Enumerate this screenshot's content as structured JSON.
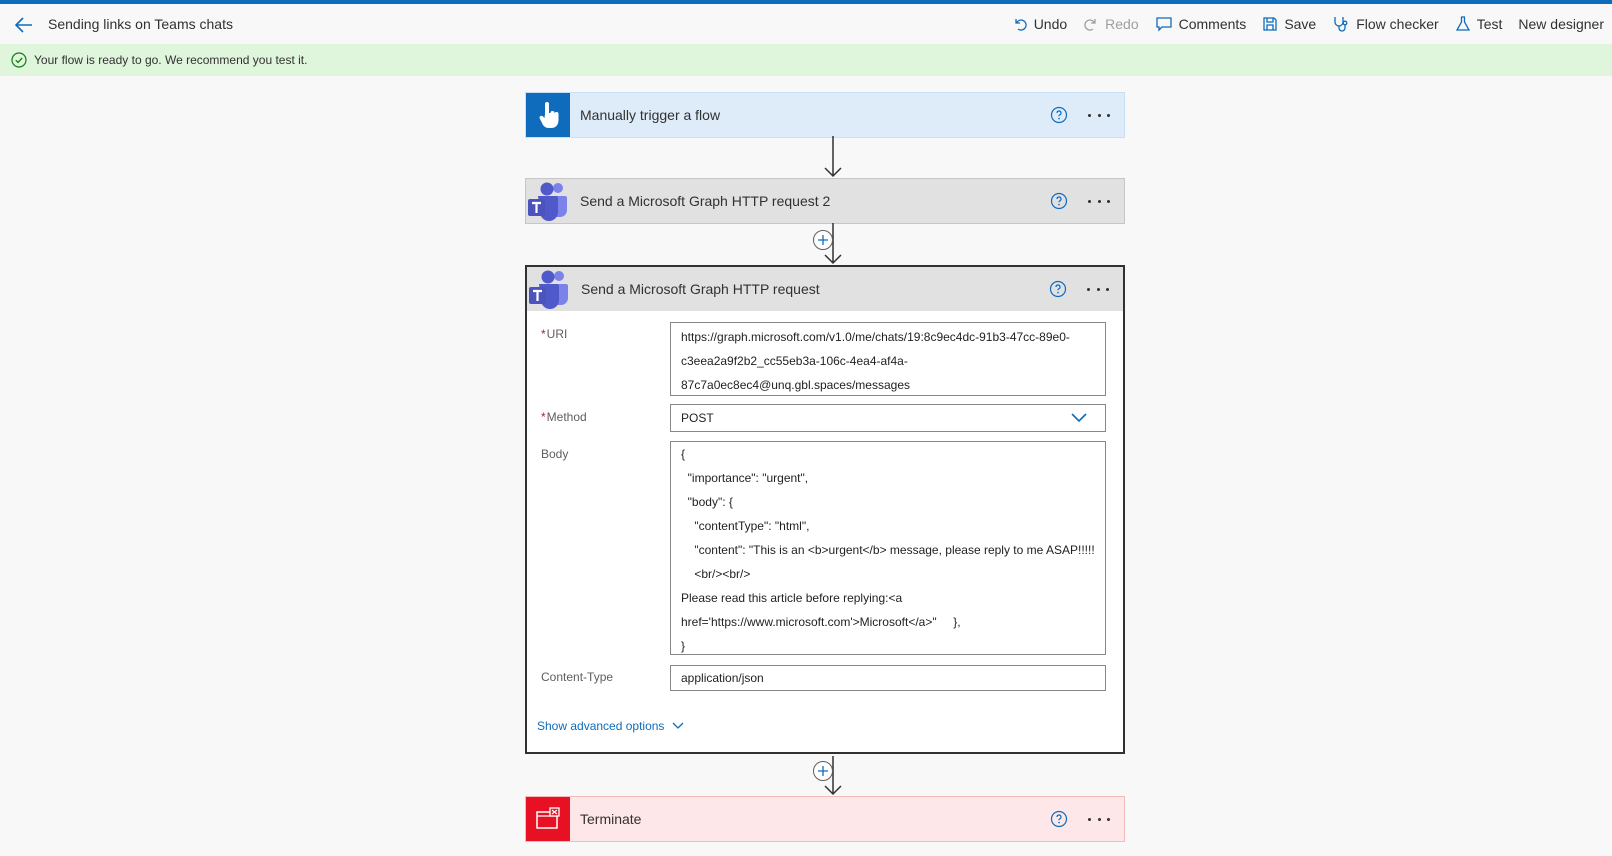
{
  "header": {
    "title": "Sending links on Teams chats",
    "commands": {
      "undo": "Undo",
      "redo": "Redo",
      "comments": "Comments",
      "save": "Save",
      "flow_checker": "Flow checker",
      "test": "Test",
      "new_designer": "New designer"
    }
  },
  "banner": {
    "message": "Your flow is ready to go. We recommend you test it."
  },
  "steps": {
    "trigger": {
      "title": "Manually trigger a flow",
      "color": "#0f6cbd"
    },
    "graph2": {
      "title": "Send a Microsoft Graph HTTP request 2"
    },
    "graph": {
      "title": "Send a Microsoft Graph HTTP request",
      "uri_label": "URI",
      "uri_lines": [
        "https://graph.microsoft.com/v1.0/me/chats/19:8c9ec4dc-91b3-47cc-89e0-",
        "c3eea2a9f2b2_cc55eb3a-106c-4ea4-af4a-",
        "87c7a0ec8ec4@unq.gbl.spaces/messages"
      ],
      "method_label": "Method",
      "method_value": "POST",
      "body_label": "Body",
      "body_lines": [
        "{",
        "  \"importance\": \"urgent\",",
        "  \"body\": {",
        "    \"contentType\": \"html\",",
        "    \"content\": \"This is an <b>urgent</b> message, please reply to me ASAP!!!!!",
        "    <br/><br/>",
        "Please read this article before replying:<a",
        "href='https://www.microsoft.com'>Microsoft</a>\"     },",
        "}"
      ],
      "content_type_label": "Content-Type",
      "content_type_value": "application/json",
      "advanced_label": "Show advanced options"
    },
    "terminate": {
      "title": "Terminate",
      "color": "#e81123"
    }
  }
}
